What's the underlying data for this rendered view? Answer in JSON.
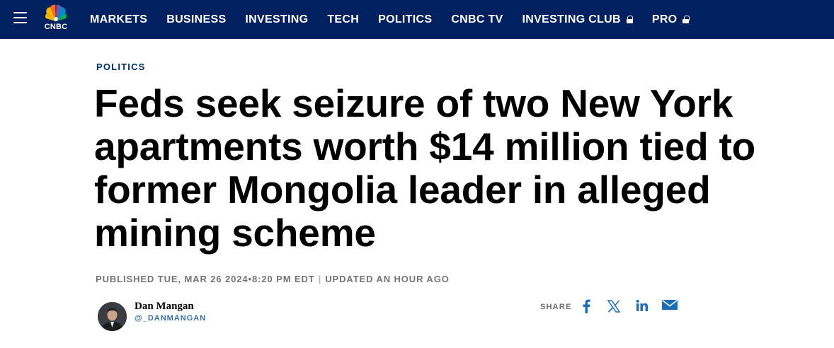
{
  "nav": {
    "logo_text": "CNBC",
    "items": [
      {
        "label": "MARKETS"
      },
      {
        "label": "BUSINESS"
      },
      {
        "label": "INVESTING"
      },
      {
        "label": "TECH"
      },
      {
        "label": "POLITICS"
      },
      {
        "label": "CNBC TV"
      },
      {
        "label": "INVESTING CLUB",
        "icon": "lock-icon"
      },
      {
        "label": "PRO",
        "icon": "lock-icon"
      }
    ],
    "background_color": "#002060"
  },
  "article": {
    "section": "POLITICS",
    "headline": "Feds seek seizure of two New York apartments worth $14 million tied to former Mongolia leader in alleged mining scheme",
    "published": "PUBLISHED TUE, MAR 26 2024•8:20 PM EDT",
    "updated": "UPDATED AN HOUR AGO",
    "timestamp_separator": "|"
  },
  "author": {
    "name": "Dan Mangan",
    "handle": "@_DANMANGAN"
  },
  "share": {
    "label": "SHARE",
    "buttons": [
      {
        "icon": "facebook-icon"
      },
      {
        "icon": "x-twitter-icon"
      },
      {
        "icon": "linkedin-icon"
      },
      {
        "icon": "email-icon"
      }
    ],
    "icon_color": "#1b6eb5"
  }
}
